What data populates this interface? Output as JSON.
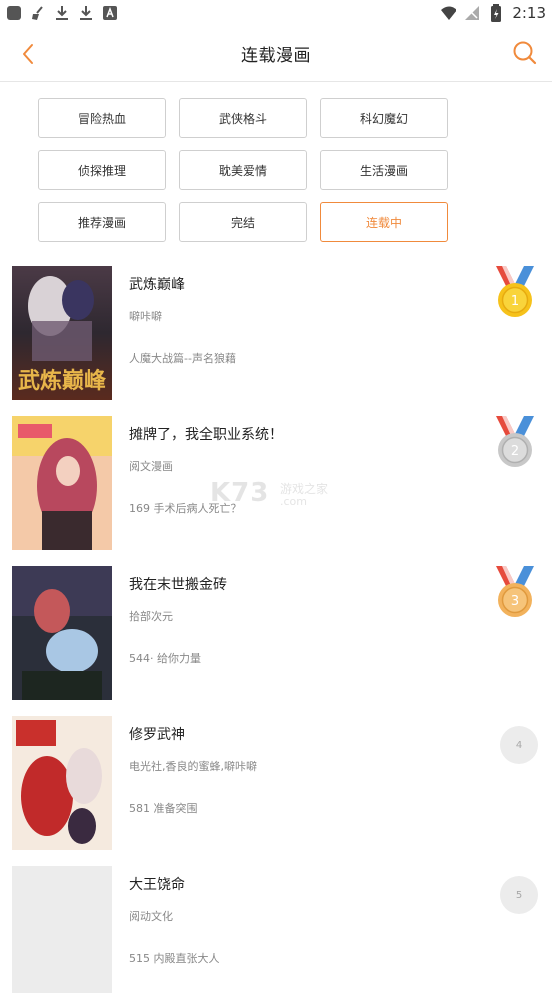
{
  "status_bar": {
    "time": "2:13"
  },
  "header": {
    "title": "连载漫画"
  },
  "filters": [
    {
      "label": "冒险热血",
      "active": false
    },
    {
      "label": "武侠格斗",
      "active": false
    },
    {
      "label": "科幻魔幻",
      "active": false
    },
    {
      "label": "侦探推理",
      "active": false
    },
    {
      "label": "耽美爱情",
      "active": false
    },
    {
      "label": "生活漫画",
      "active": false
    },
    {
      "label": "推荐漫画",
      "active": false
    },
    {
      "label": "完结",
      "active": false
    },
    {
      "label": "连载中",
      "active": true
    }
  ],
  "comics": [
    {
      "title": "武炼巅峰",
      "author": "噼咔噼",
      "latest": "人魔大战篇--声名狼藉",
      "rank": "1",
      "medal": "gold"
    },
    {
      "title": "摊牌了，我全职业系统！",
      "author": "阅文漫画",
      "latest": "169 手术后病人死亡？",
      "rank": "2",
      "medal": "silver"
    },
    {
      "title": "我在末世搬金砖",
      "author": "拾部次元",
      "latest": "544· 给你力量",
      "rank": "3",
      "medal": "bronze"
    },
    {
      "title": "修罗武神",
      "author": "电光社,香良的蜜蜂,噼咔噼",
      "latest": "581 准备突围",
      "rank": "4",
      "medal": "none"
    },
    {
      "title": "大王饶命",
      "author": "阅动文化",
      "latest": "515 内殿直张大人",
      "rank": "5",
      "medal": "none"
    }
  ],
  "watermark": {
    "brand": "K73",
    "tagline": "游戏之家",
    "domain": ".com"
  },
  "colors": {
    "accent": "#f08a3c",
    "gold": "#f6c21b",
    "silver": "#c8c8c8",
    "bronze": "#f2b25c",
    "ribbon_red": "#e64a3c",
    "ribbon_blue": "#4a90d9"
  }
}
